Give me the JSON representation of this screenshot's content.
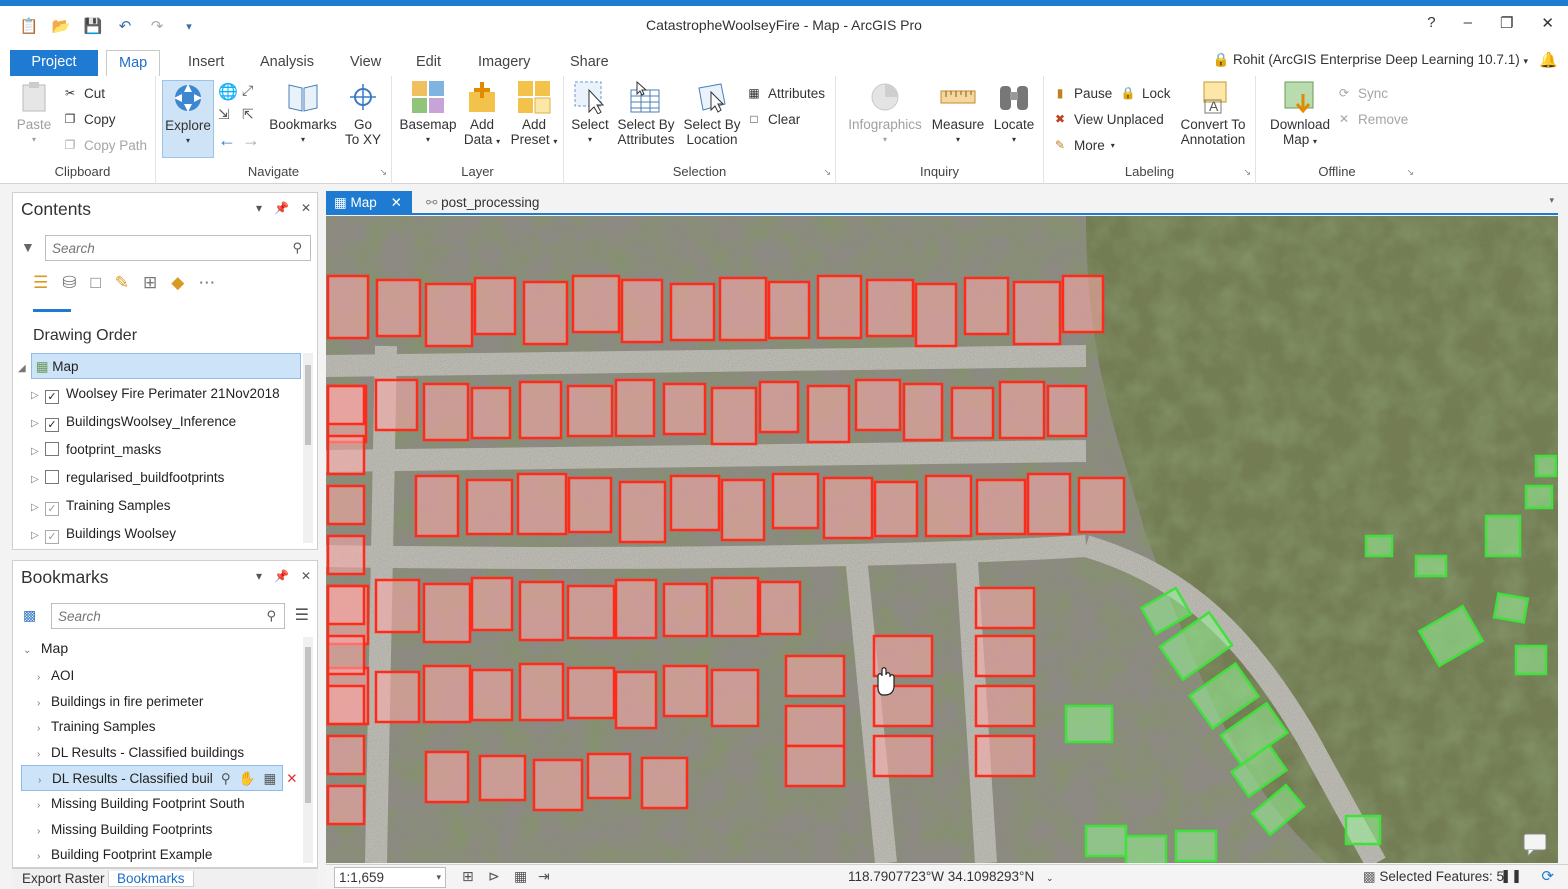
{
  "window": {
    "title": "CatastropheWoolseyFire - Map - ArcGIS Pro",
    "help": "?",
    "minimize": "–",
    "restore": "❐",
    "close": "✕"
  },
  "tabs": [
    "Project",
    "Map",
    "Insert",
    "Analysis",
    "View",
    "Edit",
    "Imagery",
    "Share"
  ],
  "user": "Rohit (ArcGIS Enterprise Deep Learning 10.7.1)",
  "ribbon": {
    "clipboard": {
      "label": "Clipboard",
      "paste": "Paste",
      "cut": "Cut",
      "copy": "Copy",
      "copy_path": "Copy Path"
    },
    "navigate": {
      "label": "Navigate",
      "explore": "Explore",
      "bookmarks": "Bookmarks",
      "go": "Go",
      "to_xy": "To XY"
    },
    "layer": {
      "label": "Layer",
      "basemap": "Basemap",
      "add": "Add",
      "data": "Data",
      "add2": "Add",
      "preset": "Preset"
    },
    "selection": {
      "label": "Selection",
      "select": "Select",
      "select_by": "Select By",
      "attributes": "Attributes",
      "select_by2": "Select By",
      "location": "Location",
      "attributes_btn": "Attributes",
      "clear": "Clear"
    },
    "inquiry": {
      "label": "Inquiry",
      "infographics": "Infographics",
      "measure": "Measure",
      "locate": "Locate"
    },
    "labeling": {
      "label": "Labeling",
      "pause": "Pause",
      "lock": "Lock",
      "view_unplaced": "View Unplaced",
      "more": "More",
      "convert_to": "Convert To",
      "annotation": "Annotation"
    },
    "offline": {
      "label": "Offline",
      "download": "Download",
      "map": "Map",
      "sync": "Sync",
      "remove": "Remove"
    }
  },
  "contents": {
    "title": "Contents",
    "search_placeholder": "Search",
    "drawing_order": "Drawing Order",
    "map_item": "Map",
    "layers": [
      {
        "name": "Woolsey Fire Perimater 21Nov2018",
        "checked": "✓"
      },
      {
        "name": "BuildingsWoolsey_Inference",
        "checked": "✓"
      },
      {
        "name": "footprint_masks",
        "checked": ""
      },
      {
        "name": "regularised_buildfootprints",
        "checked": ""
      },
      {
        "name": "Training Samples",
        "checked": "✓"
      },
      {
        "name": "Buildings Woolsey",
        "checked": "✓"
      }
    ]
  },
  "bookmarks": {
    "title": "Bookmarks",
    "search_placeholder": "Search",
    "root": "Map",
    "items": [
      "AOI",
      "Buildings in fire perimeter",
      "Training Samples",
      "DL Results - Classified buildings",
      "DL Results - Classified buil",
      "Missing Building Footprint South",
      "Missing Building Footprints",
      "Building Footprint Example"
    ]
  },
  "bottom_tabs": [
    "Export Raster",
    "Bookmarks"
  ],
  "view_tabs": {
    "map": "Map",
    "second": "post_processing"
  },
  "status": {
    "scale": "1:1,659",
    "coords": "118.7907723°W 34.1098293°N",
    "selected_features": "Selected Features: 5"
  },
  "colors": {
    "accent": "#1f7ad2",
    "damaged_outline": "#ff2a1a",
    "undamaged_outline": "#3ee23a"
  }
}
